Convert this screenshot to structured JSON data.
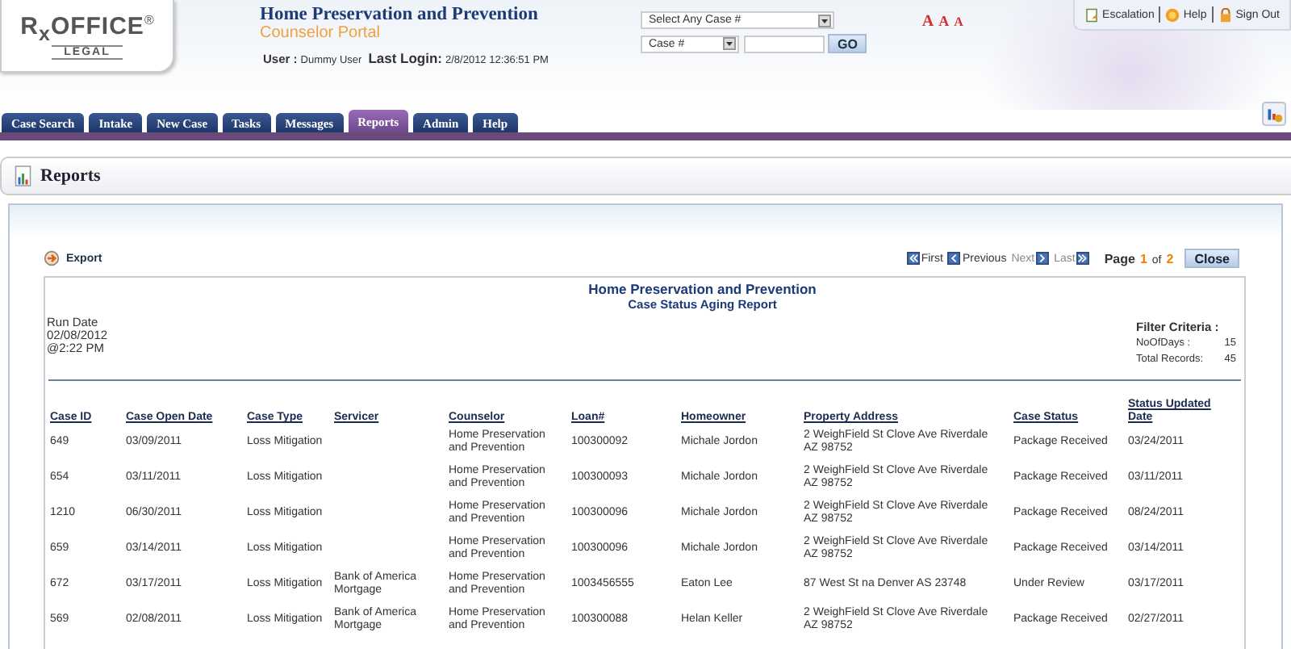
{
  "logo": {
    "brand": "R$_{x}$OFFICE",
    "registered": "®",
    "tagline": "LEGAL"
  },
  "header": {
    "title": "Home Preservation and Prevention",
    "subtitle": "Counselor Portal",
    "user_label": "User :",
    "user_value": "Dummy User",
    "login_label": "Last Login:",
    "login_value": "2/8/2012 12:36:51 PM"
  },
  "search": {
    "case_select": "Select Any Case #",
    "type_select": "Case #",
    "go": "GO"
  },
  "font_sizes": [
    "A",
    "A",
    "A"
  ],
  "top_links": [
    {
      "label": "Escalation",
      "kind": "escalation"
    },
    {
      "label": "Help",
      "kind": "help"
    },
    {
      "label": "Sign Out",
      "kind": "lock"
    }
  ],
  "tabs": [
    {
      "label": "Case Search",
      "selected": false
    },
    {
      "label": "Intake",
      "selected": false
    },
    {
      "label": "New Case",
      "selected": false
    },
    {
      "label": "Tasks",
      "selected": false
    },
    {
      "label": "Messages",
      "selected": false
    },
    {
      "label": "Reports",
      "selected": true
    },
    {
      "label": "Admin",
      "selected": false
    },
    {
      "label": "Help",
      "selected": false
    }
  ],
  "page_title": "Reports",
  "toolbar": {
    "export": "Export",
    "pager": [
      {
        "label": "First",
        "kind": "first",
        "disabled": false
      },
      {
        "label": "Previous",
        "kind": "prev",
        "disabled": false
      },
      {
        "label": "Next",
        "kind": "next",
        "disabled": true
      },
      {
        "label": "Last",
        "kind": "last",
        "disabled": true
      }
    ],
    "page_label": "Page",
    "page": "1",
    "of": "of",
    "pages": "2",
    "close": "Close"
  },
  "report": {
    "title": "Home Preservation and Prevention",
    "subtitle": "Case Status Aging Report",
    "run_date": [
      "Run Date",
      "02/08/2012",
      "@2:22 PM"
    ],
    "filter_title": "Filter Criteria :",
    "filters": [
      {
        "label": "NoOfDays :",
        "value": "15"
      },
      {
        "label": "Total Records:",
        "value": "45"
      }
    ]
  },
  "table": {
    "columns": [
      "Case ID",
      "Case Open Date",
      "Case Type",
      "Servicer",
      "Counselor",
      "Loan#",
      "Homeowner",
      "Property Address",
      "Case Status",
      "Status Updated Date"
    ],
    "rows": [
      [
        "649",
        "03/09/2011",
        "Loss Mitigation",
        "",
        "Home Preservation and Prevention",
        "100300092",
        "Michale Jordon",
        "2 WeighField St Clove Ave Riverdale AZ 98752",
        "Package Received",
        "03/24/2011"
      ],
      [
        "654",
        "03/11/2011",
        "Loss Mitigation",
        "",
        "Home Preservation and Prevention",
        "100300093",
        "Michale Jordon",
        "2 WeighField St Clove Ave Riverdale AZ 98752",
        "Package Received",
        "03/11/2011"
      ],
      [
        "1210",
        "06/30/2011",
        "Loss Mitigation",
        "",
        "Home Preservation and Prevention",
        "100300096",
        "Michale Jordon",
        "2 WeighField St Clove Ave Riverdale AZ 98752",
        "Package Received",
        "08/24/2011"
      ],
      [
        "659",
        "03/14/2011",
        "Loss Mitigation",
        "",
        "Home Preservation and Prevention",
        "100300096",
        "Michale Jordon",
        "2 WeighField St Clove Ave Riverdale AZ 98752",
        "Package Received",
        "03/14/2011"
      ],
      [
        "672",
        "03/17/2011",
        "Loss Mitigation",
        "Bank of America Mortgage",
        "Home Preservation and Prevention",
        "1003456555",
        "Eaton Lee",
        "87 West St na Denver AS 23748",
        "Under Review",
        "03/17/2011"
      ],
      [
        "569",
        "02/08/2011",
        "Loss Mitigation",
        "Bank of America Mortgage",
        "Home Preservation and Prevention",
        "100300088",
        "Helan Keller",
        "2 WeighField St Clove Ave Riverdale AZ 98752",
        "Package Received",
        "02/27/2011"
      ]
    ]
  }
}
